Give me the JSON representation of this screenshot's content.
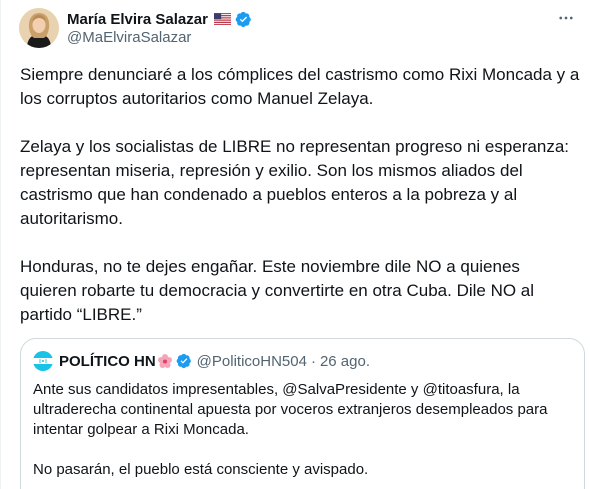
{
  "author": {
    "name": "María Elvira Salazar",
    "handle": "@MaElviraSalazar"
  },
  "icons": {
    "flag": "us-flag-icon",
    "verified": "verified-badge-icon",
    "more": "more-options-icon"
  },
  "colors": {
    "verified": "#1d9bf0",
    "secondary_text": "#536471",
    "border": "#cfd9de"
  },
  "tweet": {
    "paragraphs": [
      "Siempre denunciaré a los cómplices del castrismo como Rixi Moncada y a los corruptos autoritarios como Manuel Zelaya.",
      "Zelaya y los socialistas de LIBRE no representan progreso ni esperanza: representan miseria, represión y exilio. Son los mismos aliados del castrismo que han condenado a pueblos enteros a la pobreza y al autoritarismo.",
      "Honduras, no te dejes engañar. Este noviembre dile NO a quienes quieren robarte tu democracia y convertirte en otra Cuba. Dile NO al partido “LIBRE.”"
    ]
  },
  "quoted": {
    "name": "POLÍTICO HN",
    "handle": "@PoliticoHN504",
    "separator": "·",
    "date": "26 ago.",
    "paragraphs": [
      "Ante sus candidatos impresentables, @SalvaPresidente y @titoasfura, la ultraderecha continental apuesta por voceros extranjeros desempleados para intentar golpear a Rixi Moncada.",
      "No pasarán, el pueblo está consciente y avispado."
    ]
  }
}
